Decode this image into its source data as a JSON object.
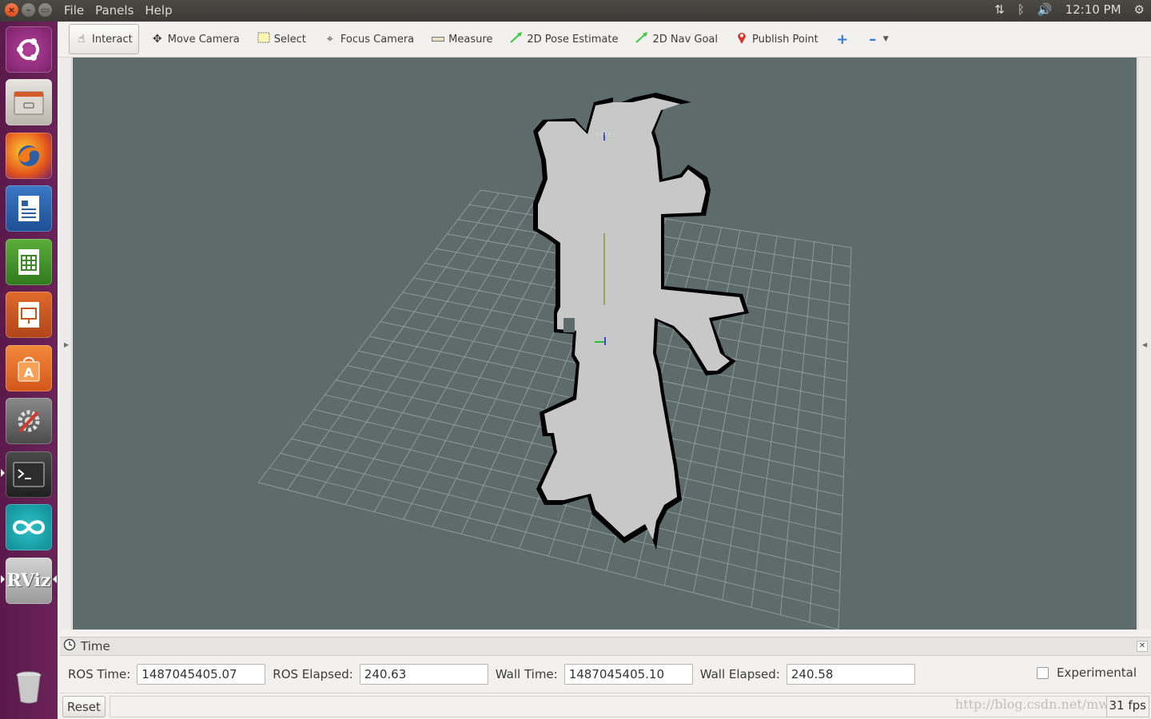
{
  "top_panel": {
    "menus": [
      "File",
      "Panels",
      "Help"
    ],
    "clock": "12:10 PM",
    "indicators": [
      "network-icon",
      "bluetooth-icon",
      "volume-icon",
      "gear-icon"
    ]
  },
  "launcher": {
    "items": [
      {
        "name": "ubuntu-dash-icon",
        "color": "#8a2b7a"
      },
      {
        "name": "files-icon",
        "color": "#d9d6cf"
      },
      {
        "name": "firefox-icon",
        "color": "#e66a1f"
      },
      {
        "name": "writer-icon",
        "color": "#2c5f9e"
      },
      {
        "name": "calc-icon",
        "color": "#3e8a2a"
      },
      {
        "name": "impress-icon",
        "color": "#c9541b"
      },
      {
        "name": "software-center-icon",
        "color": "#e36a2c"
      },
      {
        "name": "system-settings-icon",
        "color": "#7a7a7a"
      },
      {
        "name": "terminal-icon",
        "color": "#2d2d2d"
      },
      {
        "name": "arduino-icon",
        "color": "#16a0a8"
      },
      {
        "name": "rviz-icon",
        "color": "#c8c8c8",
        "label": "RViz"
      },
      {
        "name": "trash-icon",
        "color": "#c8c8c8"
      }
    ]
  },
  "toolbar": {
    "tools": [
      {
        "name": "interact-tool",
        "label": "Interact",
        "icon": "hand-icon",
        "active": true
      },
      {
        "name": "move-camera-tool",
        "label": "Move Camera",
        "icon": "move-icon"
      },
      {
        "name": "select-tool",
        "label": "Select",
        "icon": "select-icon"
      },
      {
        "name": "focus-camera-tool",
        "label": "Focus Camera",
        "icon": "focus-icon"
      },
      {
        "name": "measure-tool",
        "label": "Measure",
        "icon": "ruler-icon"
      },
      {
        "name": "pose-estimate-tool",
        "label": "2D Pose Estimate",
        "icon": "green-arrow-icon"
      },
      {
        "name": "nav-goal-tool",
        "label": "2D Nav Goal",
        "icon": "green-arrow-icon"
      },
      {
        "name": "publish-point-tool",
        "label": "Publish Point",
        "icon": "map-pin-icon"
      }
    ],
    "colors": {
      "green_arrow": "#3cc63c",
      "pin": "#d43a2a",
      "plus": "#3a78d6"
    }
  },
  "viewport": {
    "background": "#5d6b6b",
    "grid_color": "#8c9a9a",
    "map_free": "#c8c8c8",
    "map_occupied": "#000000"
  },
  "time_panel": {
    "title": "Time",
    "ros_time_label": "ROS Time:",
    "ros_time": "1487045405.07",
    "ros_elapsed_label": "ROS Elapsed:",
    "ros_elapsed": "240.63",
    "wall_time_label": "Wall Time:",
    "wall_time": "1487045405.10",
    "wall_elapsed_label": "Wall Elapsed:",
    "wall_elapsed": "240.58",
    "experimental_label": "Experimental"
  },
  "status_bar": {
    "reset_label": "Reset",
    "fps": "31 fps",
    "watermark": "http://blog.csdn.net/mw"
  }
}
